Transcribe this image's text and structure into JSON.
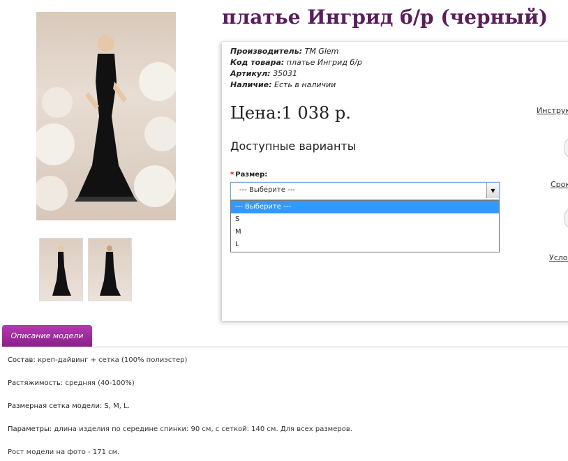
{
  "product": {
    "title": "платье Ингрид б/р (черный)",
    "meta": {
      "manufacturer_label": "Производитель:",
      "manufacturer_value": "ТМ Glem",
      "code_label": "Код товара:",
      "code_value": "платье Ингрид б/р",
      "sku_label": "Артикул:",
      "sku_value": "35031",
      "stock_label": "Наличие:",
      "stock_value": "Есть в наличии"
    },
    "price": "Цена:1 038 р.",
    "variants_heading": "Доступные варианты",
    "size_label": "Размер:",
    "size_required_mark": "*",
    "size_select": {
      "value": "--- Выберите ---",
      "options": [
        "--- Выберите ---",
        "S",
        "M",
        "L"
      ]
    },
    "side_links": {
      "instructions": "Инструк",
      "terms": "Срок",
      "conditions": "Услов"
    }
  },
  "tabs": {
    "description": "Описание модели"
  },
  "description": {
    "composition_label": "Состав:",
    "composition_value": "креп-дайвинг + сетка (100% полиэстер)",
    "stretch_label": "Растяжимость:",
    "stretch_value": "средняя (40-100%)",
    "sizes_label": "Размерная сетка модели:",
    "sizes_value": "S, M, L.",
    "params_label": "Параметры:",
    "params_value": "длина изделия по середине спинки:  90 см, с сеткой: 140 см. Для всех размеров.",
    "height_text": "Рост модели на фото - 171 см."
  },
  "colors": {
    "title": "#5b1d5c",
    "tab": "#a02c9e",
    "select_highlight": "#3399ff",
    "required": "#e00000"
  },
  "icons": {
    "dropdown": "chevron-down-icon"
  }
}
